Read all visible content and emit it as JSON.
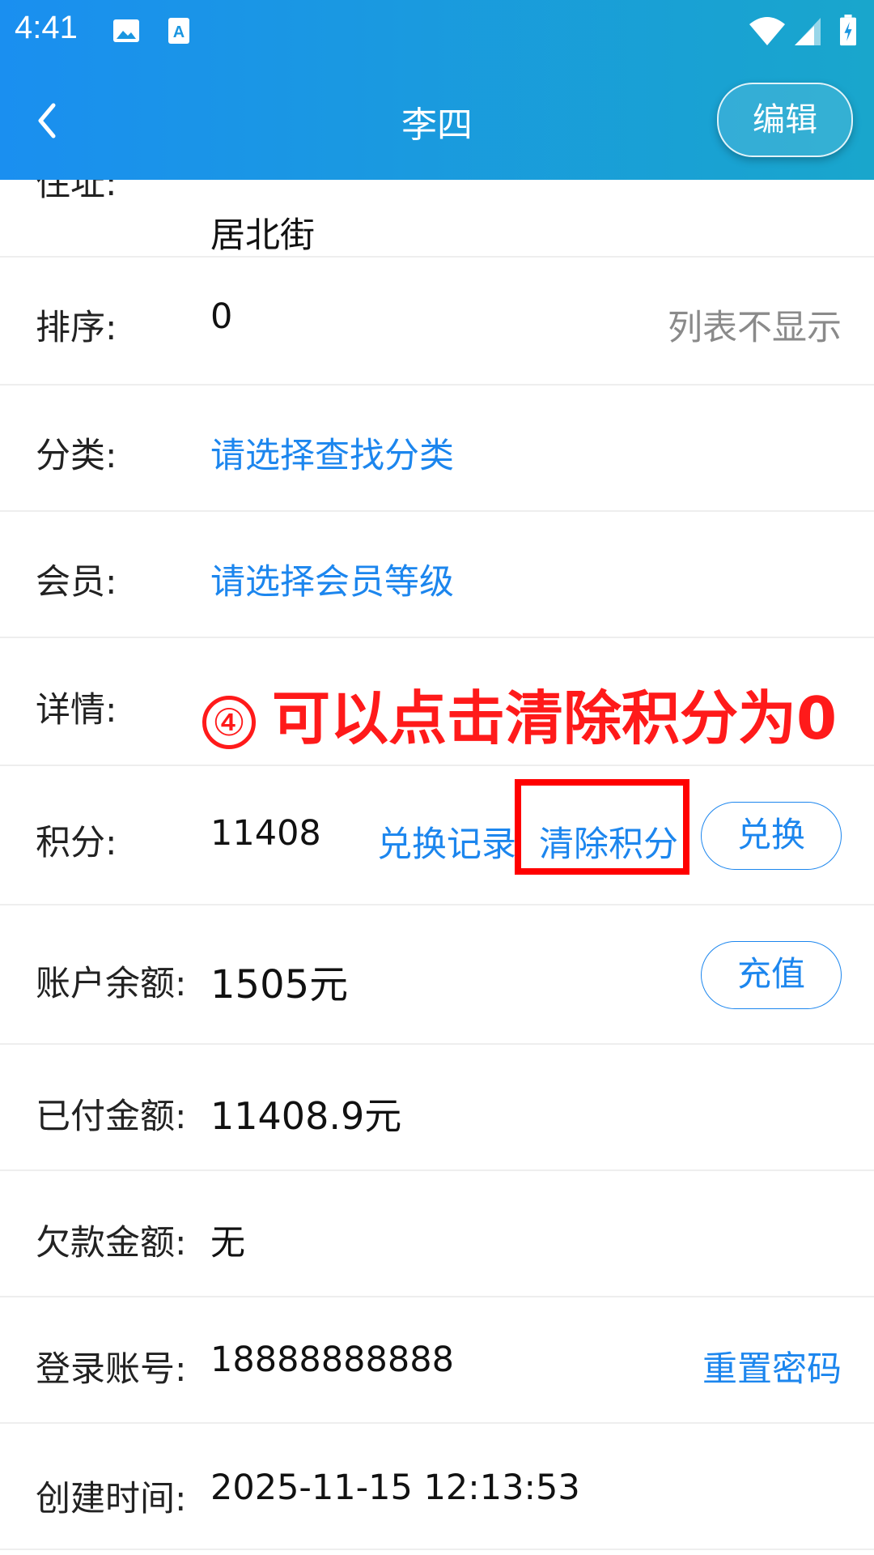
{
  "status_bar": {
    "time": "4:41"
  },
  "app_bar": {
    "title": "李四",
    "edit_label": "编辑"
  },
  "address_row": {
    "label": "住址:",
    "value": "居北街"
  },
  "sort_row": {
    "label": "排序:",
    "value": "0",
    "hint": "列表不显示"
  },
  "category_row": {
    "label": "分类:",
    "value": "请选择查找分类"
  },
  "member_row": {
    "label": "会员:",
    "value": "请选择会员等级"
  },
  "detail_row": {
    "label": "详情:"
  },
  "annotation": {
    "number": "④",
    "text": "可以点击清除积分为0"
  },
  "points_row": {
    "label": "积分:",
    "value": "11408",
    "history_label": "兑换记录",
    "clear_label": "清除积分",
    "redeem_label": "兑换"
  },
  "balance_row": {
    "label": "账户余额:",
    "value": "1505元",
    "topup_label": "充值"
  },
  "paid_row": {
    "label": "已付金额:",
    "value": "11408.9元"
  },
  "debt_row": {
    "label": "欠款金额:",
    "value": "无"
  },
  "login_row": {
    "label": "登录账号:",
    "value": "18888888888",
    "reset_label": "重置密码"
  },
  "created_row": {
    "label": "创建时间:",
    "value": "2025-11-15 12:13:53"
  },
  "colors": {
    "header_start": "#1a8ff0",
    "header_end": "#19a6cc",
    "link": "#1c86ee",
    "annotation": "#ff1a1a"
  }
}
